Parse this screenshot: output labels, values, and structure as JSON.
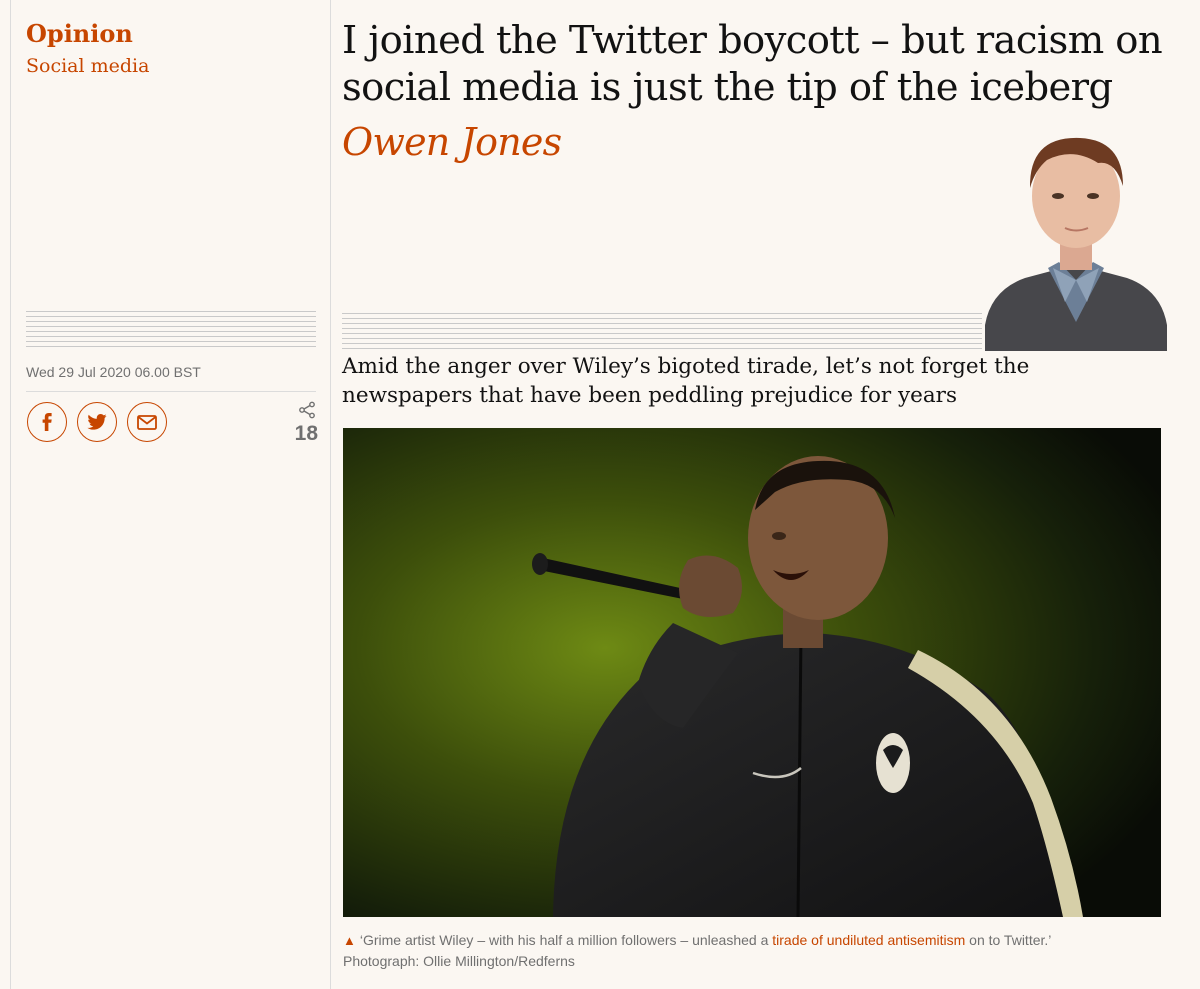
{
  "article": {
    "section": "Opinion",
    "series": "Social media",
    "headline": "I joined the Twitter boycott – but racism on social media is just the tip of the iceberg",
    "byline": "Owen Jones",
    "dateline": "Wed 29 Jul 2020 06.00 BST",
    "standfirst": "Amid the anger over Wiley’s bigoted tirade, let’s not forget the newspapers that have been peddling prejudice for years"
  },
  "share": {
    "buttons": [
      {
        "name": "facebook-share-button",
        "icon": "facebook-icon"
      },
      {
        "name": "twitter-share-button",
        "icon": "twitter-icon"
      },
      {
        "name": "email-share-button",
        "icon": "email-icon"
      }
    ],
    "count": "18",
    "count_icon": "share-icon"
  },
  "caption": {
    "icon": "triangle-up-icon",
    "text_before": "‘Grime artist Wiley – with his half a million followers – unleashed a ",
    "link_text": "tirade of undiluted antisemitism",
    "text_after": " on to Twitter.’",
    "credit": "Photograph: Ollie Millington/Redferns"
  },
  "colors": {
    "accent": "#c74600",
    "text": "#121212",
    "muted": "#707070",
    "background": "#fbf7f2"
  }
}
